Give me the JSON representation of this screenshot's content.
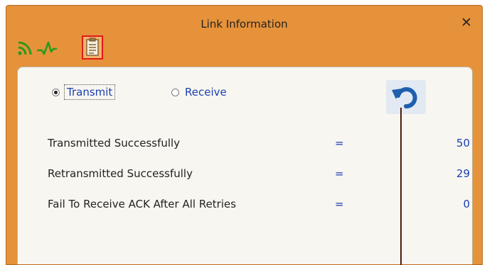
{
  "window": {
    "title": "Link Information",
    "close_label": "✕"
  },
  "tabs": [
    {
      "icon": "signal-icon"
    },
    {
      "icon": "statistics-wave-icon"
    },
    {
      "icon": "document-list-icon",
      "selected": true
    }
  ],
  "radio": {
    "transmit_label": "Transmit",
    "receive_label": "Receive",
    "selected": "Transmit"
  },
  "stats": [
    {
      "label": "Transmitted Successfully",
      "eq": "=",
      "value": "50"
    },
    {
      "label": "Retransmitted Successfully",
      "eq": "=",
      "value": "29"
    },
    {
      "label": "Fail To Receive ACK After All Retries",
      "eq": "=",
      "value": "0"
    }
  ],
  "colors": {
    "titlebar": "#e6923a",
    "accent_text": "#1b3fb3",
    "refresh_arrow": "#1e5fae",
    "tab_highlight": "#e01a1a"
  }
}
